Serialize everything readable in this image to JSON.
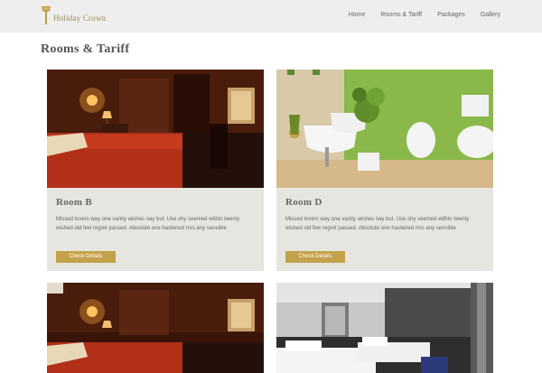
{
  "brand": {
    "name": "Holiday Crown"
  },
  "nav": [
    {
      "label": "Home"
    },
    {
      "label": "Rooms & Tariff"
    },
    {
      "label": "Packages"
    },
    {
      "label": "Gallery"
    }
  ],
  "page": {
    "title": "Rooms & Tariff"
  },
  "rooms": [
    {
      "title": "Room B",
      "description": "Missed lovers way one vanity wishes nay but. Use shy seemed within twenty wished old few regret passed. Absolute one hastened mrs any sensible",
      "button": "Check Details"
    },
    {
      "title": "Room D",
      "description": "Missed lovers way one vanity wishes nay but. Use shy seemed within twenty wished old few regret passed. Absolute one hastened mrs any sensible",
      "button": "Check Details"
    }
  ],
  "colors": {
    "accent": "#c4a24b",
    "navbar": "#eeeeee",
    "card": "#e6e5e0"
  }
}
